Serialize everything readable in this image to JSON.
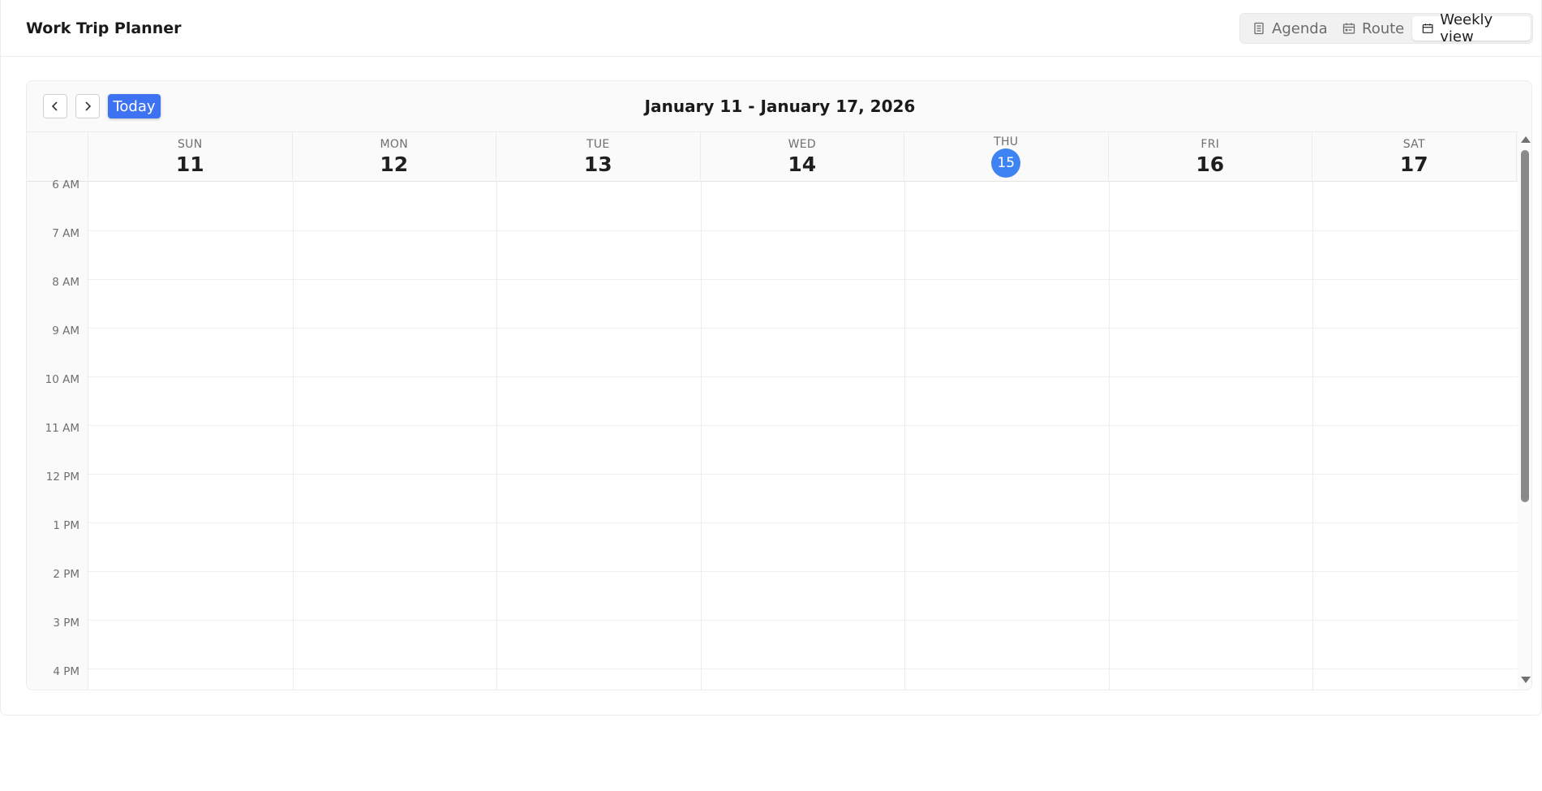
{
  "app": {
    "title": "Work Trip Planner"
  },
  "view_switcher": {
    "agenda": {
      "label": "Agenda",
      "icon": "list-icon"
    },
    "route": {
      "label": "Route",
      "icon": "route-calendar-icon"
    },
    "weekly": {
      "label": "Weekly view",
      "icon": "calendar-icon",
      "active": true
    }
  },
  "calendar": {
    "range_title": "January 11 - January 17, 2026",
    "today_label": "Today",
    "days": [
      {
        "name": "SUN",
        "num": "11"
      },
      {
        "name": "MON",
        "num": "12"
      },
      {
        "name": "TUE",
        "num": "13"
      },
      {
        "name": "WED",
        "num": "14"
      },
      {
        "name": "THU",
        "num": "15",
        "today": true
      },
      {
        "name": "FRI",
        "num": "16"
      },
      {
        "name": "SAT",
        "num": "17"
      }
    ],
    "hours": [
      "6 AM",
      "7 AM",
      "8 AM",
      "9 AM",
      "10 AM",
      "11 AM",
      "12 PM",
      "1 PM",
      "2 PM",
      "3 PM",
      "4 PM"
    ]
  },
  "colors": {
    "accent": "#3d73f2",
    "today_circle": "#3d84f2"
  }
}
